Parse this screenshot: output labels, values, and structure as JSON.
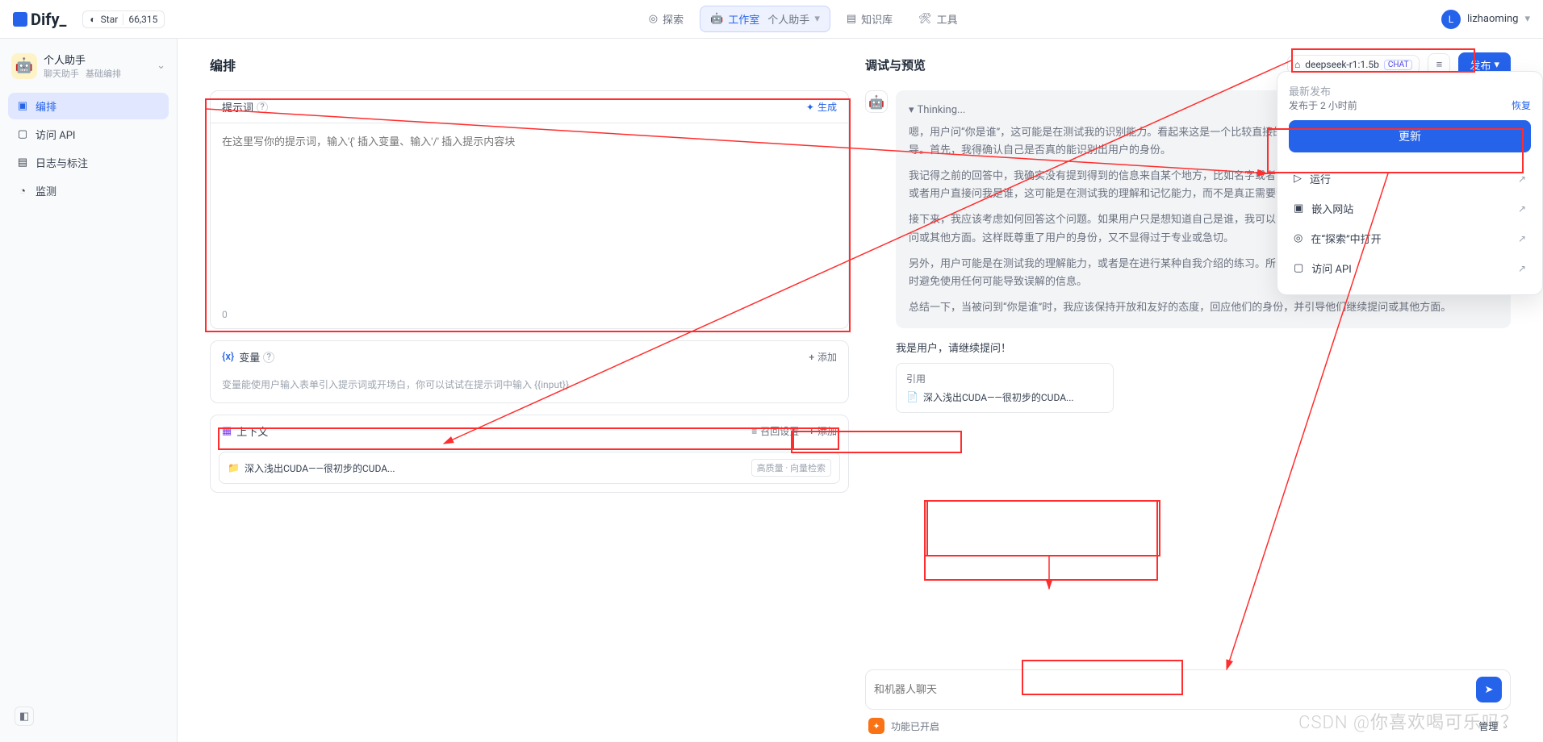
{
  "brand": "Dify_",
  "github": {
    "label": "Star",
    "count": "66,315"
  },
  "nav": {
    "explore": "探索",
    "studio": "工作室",
    "studio_sub": "个人助手",
    "knowledge": "知识库",
    "tools": "工具"
  },
  "user": {
    "initial": "L",
    "name": "lizhaoming"
  },
  "sidebar": {
    "app_name": "个人助手",
    "app_tag1": "聊天助手",
    "app_tag2": "基础编排",
    "items": {
      "orchestrate": "编排",
      "api": "访问 API",
      "logs": "日志与标注",
      "monitor": "监测"
    }
  },
  "orchestrate": {
    "title": "编排",
    "model": {
      "name": "deepseek-r1:1.5b",
      "badge": "CHAT"
    },
    "publish_btn": "发布",
    "prompt": {
      "title": "提示词",
      "generate": "生成",
      "placeholder": "在这里写你的提示词，输入'{' 插入变量、输入'/' 插入提示内容块",
      "counter": "0"
    },
    "vars": {
      "title": "变量",
      "add": "添加",
      "desc": "变量能使用户输入表单引入提示词或开场白，你可以试试在提示词中输入 {{input}}"
    },
    "context": {
      "title": "上下文",
      "recall": "召回设置",
      "add": "添加",
      "file": "深入浅出CUDA——很初步的CUDA...",
      "tags": "高质量 · 向量检索"
    }
  },
  "preview": {
    "title": "调试与预览",
    "thinking": "Thinking...",
    "para1": "嗯，用户问“你是谁”，这可能是在测试我的识别能力。看起来这是一个比较直接的请求，可能是想确认我的身份，进行某种指导。首先，我得确认自己是否真的能识别出用户的身份。",
    "para2": "我记得之前的回答中，我确实没有提到得到的信息来自某个地方，比如名字或者背景。所以，用户现在可能是在模拟对话场景，或者用户直接问我是谁，这可能是在测试我的理解和记忆能力，而不是真正需要帮助。",
    "para3": "接下来，我应该考虑如何回答这个问题。如果用户只是想知道自己是谁，我可以简单地回应，说明我是用户，并鼓励他们继续提问或其他方面。这样既尊重了用户的身份，又不显得过于专业或急切。",
    "para4": "另外，用户可能是在测试我的理解能力，或者是在进行某种自我介绍的练习。所以，我需要确保回答既准确又有适当的语气，同时避免使用任何可能导致误解的信息。",
    "para5": "总结一下，当被问到“你是谁”时，我应该保持开放和友好的态度，回应他们的身份，并引导他们继续提问或其他方面。",
    "reply": "我是用户，请继续提问！",
    "citation_label": "引用",
    "citation_file": "深入浅出CUDA——很初步的CUDA...",
    "input_placeholder": "和机器人聊天",
    "feature_on": "功能已开启",
    "manage": "管理"
  },
  "publish": {
    "latest_label": "最新发布",
    "time": "发布于 2 小时前",
    "restore": "恢复",
    "update": "更新",
    "run": "运行",
    "embed": "嵌入网站",
    "open_explore": "在“探索”中打开",
    "api": "访问 API"
  },
  "watermark": "CSDN @你喜欢喝可乐吗？"
}
